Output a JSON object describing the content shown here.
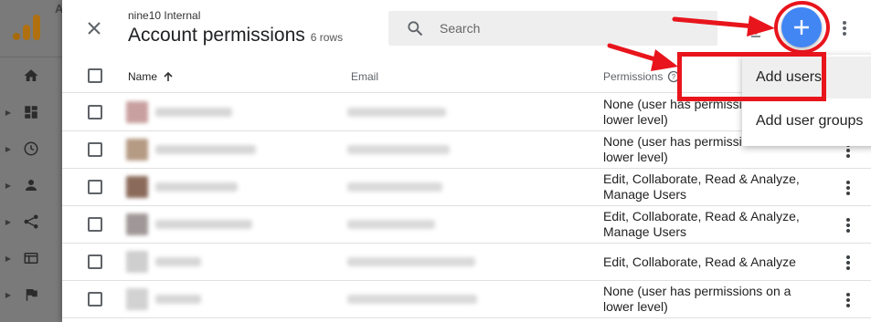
{
  "sidebar": {
    "logo_letter": "A",
    "items": [
      {
        "icon": "home-icon"
      },
      {
        "icon": "dashboard-icon"
      },
      {
        "icon": "clock-icon"
      },
      {
        "icon": "person-icon"
      },
      {
        "icon": "share-icon"
      },
      {
        "icon": "display-icon"
      },
      {
        "icon": "flag-icon"
      }
    ]
  },
  "header": {
    "subtitle": "nine10 Internal",
    "title": "Account permissions",
    "row_count": "6 rows",
    "search_placeholder": "Search"
  },
  "table": {
    "columns": {
      "name": "Name",
      "email": "Email",
      "permissions": "Permissions"
    },
    "rows": [
      {
        "perm1": "None (user has permissions on a",
        "perm2": "lower level)",
        "avatar": "#c9a0a0",
        "nw": 84,
        "mw": 108
      },
      {
        "perm1": "None (user has permissions on a",
        "perm2": "lower level)",
        "avatar": "#b59a84",
        "nw": 110,
        "mw": 112
      },
      {
        "perm1": "Edit, Collaborate, Read & Analyze,",
        "perm2": "Manage Users",
        "avatar": "#8a6a5a",
        "nw": 90,
        "mw": 104
      },
      {
        "perm1": "Edit, Collaborate, Read & Analyze,",
        "perm2": "Manage Users",
        "avatar": "#a09898",
        "nw": 106,
        "mw": 96
      },
      {
        "perm1": "Edit, Collaborate, Read & Analyze",
        "perm2": "",
        "avatar": "#cfcfcf",
        "nw": 50,
        "mw": 140
      },
      {
        "perm1": "None (user has permissions on a",
        "perm2": "lower level)",
        "avatar": "#d2d2d2",
        "nw": 50,
        "mw": 142
      }
    ]
  },
  "menu": {
    "add_users": "Add users",
    "add_user_groups": "Add user groups"
  },
  "colors": {
    "accent_blue": "#4286f4",
    "annotation_red": "#e8151c",
    "ga_orange": "#f9ab00",
    "ga_dark_orange": "#e37400"
  }
}
